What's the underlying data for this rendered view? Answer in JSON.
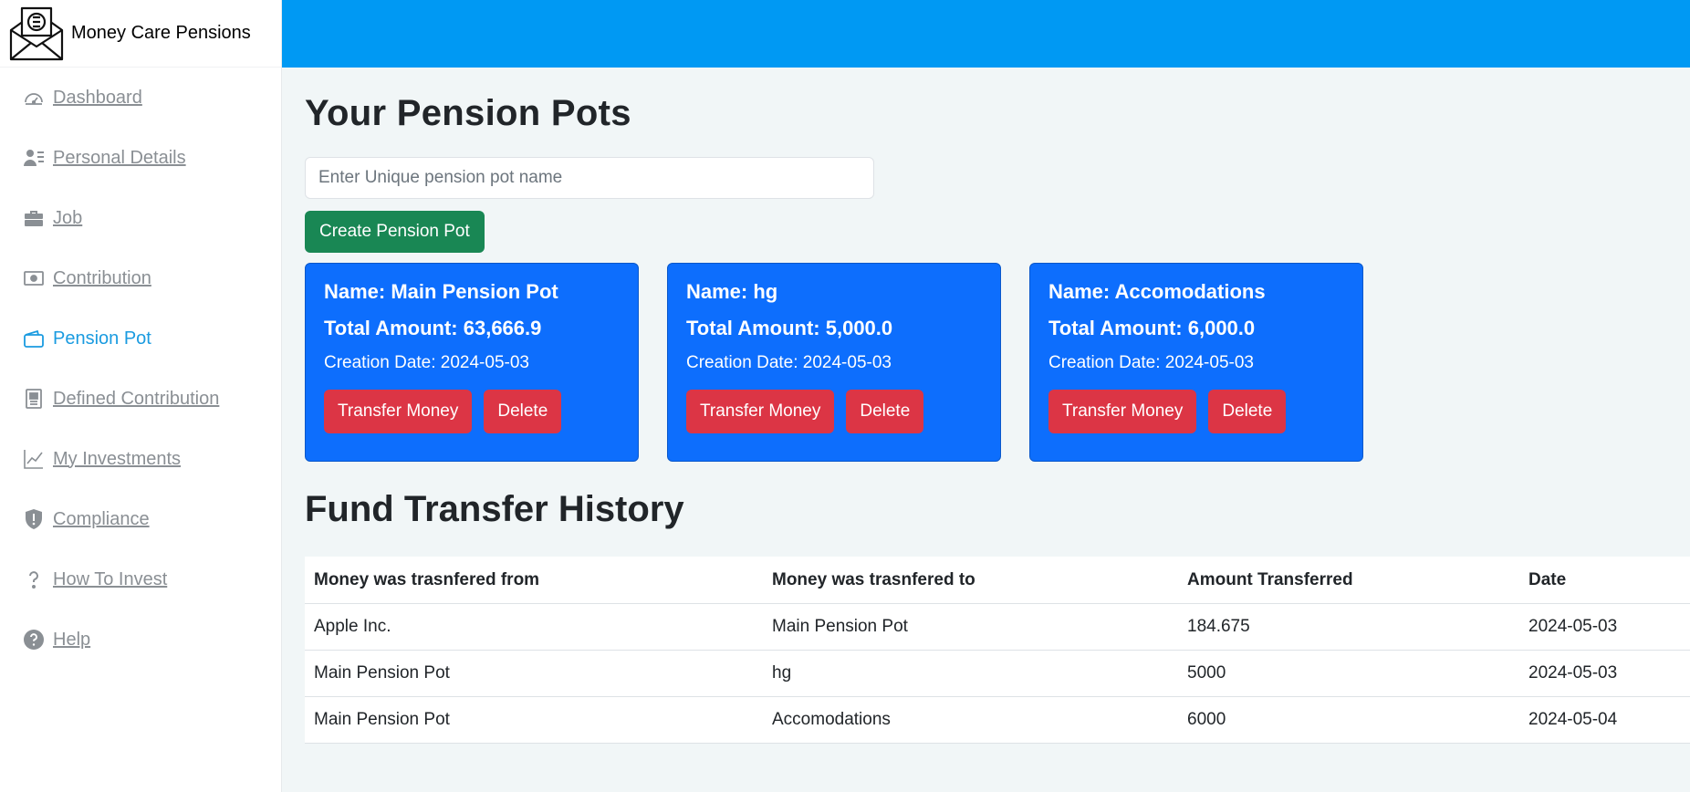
{
  "app": {
    "name": "Money Care Pensions"
  },
  "sidebar": {
    "items": [
      {
        "label": "Dashboard",
        "icon": "speedometer-icon"
      },
      {
        "label": "Personal Details",
        "icon": "person-lines-icon"
      },
      {
        "label": "Job",
        "icon": "briefcase-icon"
      },
      {
        "label": "Contribution",
        "icon": "cash-icon"
      },
      {
        "label": "Pension Pot",
        "icon": "wallet-icon",
        "active": true
      },
      {
        "label": "Defined Contribution",
        "icon": "journal-icon"
      },
      {
        "label": "My Investments",
        "icon": "graph-icon"
      },
      {
        "label": "Compliance",
        "icon": "shield-exclamation-icon"
      },
      {
        "label": "How To Invest",
        "icon": "question-icon"
      },
      {
        "label": "Help",
        "icon": "question-circle-icon"
      }
    ]
  },
  "main": {
    "title": "Your Pension Pots",
    "input_placeholder": "Enter Unique pension pot name",
    "input_value": "",
    "create_button": "Create Pension Pot",
    "pots": [
      {
        "name": "Name: Main Pension Pot",
        "total": "Total Amount: 63,666.9",
        "date": "Creation Date: 2024-05-03",
        "transfer": "Transfer Money",
        "delete": "Delete"
      },
      {
        "name": "Name: hg",
        "total": "Total Amount: 5,000.0",
        "date": "Creation Date: 2024-05-03",
        "transfer": "Transfer Money",
        "delete": "Delete"
      },
      {
        "name": "Name: Accomodations",
        "total": "Total Amount: 6,000.0",
        "date": "Creation Date: 2024-05-03",
        "transfer": "Transfer Money",
        "delete": "Delete"
      }
    ],
    "history_title": "Fund Transfer History",
    "history": {
      "columns": [
        "Money was trasnfered from",
        "Money was trasnfered to",
        "Amount Transferred",
        "Date"
      ],
      "rows": [
        [
          "Apple Inc.",
          "Main Pension Pot",
          "184.675",
          "2024-05-03"
        ],
        [
          "Main Pension Pot",
          "hg",
          "5000",
          "2024-05-03"
        ],
        [
          "Main Pension Pot",
          "Accomodations",
          "6000",
          "2024-05-04"
        ]
      ]
    }
  },
  "colors": {
    "topbar": "#0099f3",
    "card": "#0d6efd",
    "create_button": "#198754",
    "danger": "#dc3545",
    "active_nav": "#1a9be0"
  }
}
